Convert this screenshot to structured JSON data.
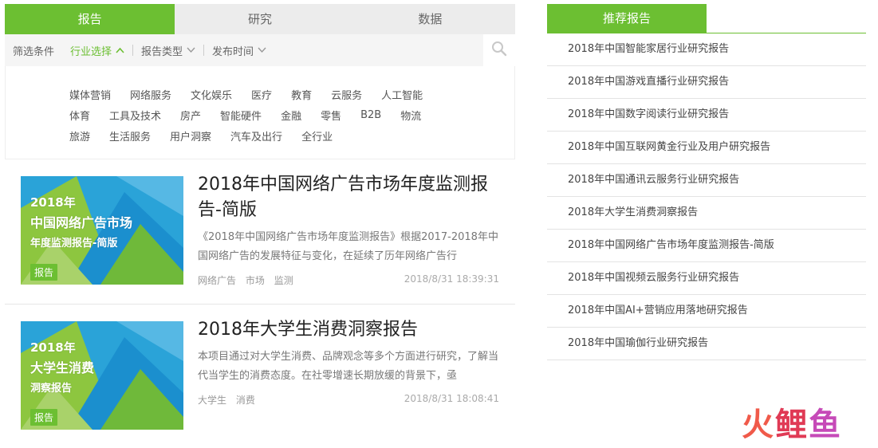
{
  "tabs": [
    "报告",
    "研究",
    "数据"
  ],
  "filter": {
    "label": "筛选条件",
    "industry": "行业选择",
    "type": "报告类型",
    "time": "发布时间"
  },
  "tags": [
    [
      "媒体营销",
      "网络服务",
      "文化娱乐",
      "医疗",
      "教育",
      "云服务",
      "人工智能"
    ],
    [
      "体育",
      "工具及技术",
      "房产",
      "智能硬件",
      "金融",
      "零售",
      "B2B",
      "物流"
    ],
    [
      "旅游",
      "生活服务",
      "用户洞察",
      "汽车及出行",
      "全行业"
    ]
  ],
  "articles": [
    {
      "thumb_lines": [
        "2018年",
        "中国网络广告市场",
        "年度监测报告-简版"
      ],
      "badge": "报告",
      "title": "2018年中国网络广告市场年度监测报告-简版",
      "desc": "《2018年中国网络广告市场年度监测报告》根据2017-2018年中国网络广告的发展特征与变化，在延续了历年网络广告行",
      "tags": [
        "网络广告",
        "市场",
        "监测"
      ],
      "time": "2018/8/31 18:39:31"
    },
    {
      "thumb_lines": [
        "2018年",
        "大学生消费",
        "洞察报告"
      ],
      "badge": "报告",
      "title": "2018年大学生消费洞察报告",
      "desc": "本项目通过对大学生消费、品牌观念等多个方面进行研究，了解当代当学生的消费态度。在社零增速长期放缓的背景下，亟",
      "tags": [
        "大学生",
        "消费"
      ],
      "time": "2018/8/31 18:08:41"
    }
  ],
  "recommend": {
    "title": "推荐报告",
    "items": [
      "2018年中国智能家居行业研究报告",
      "2018年中国游戏直播行业研究报告",
      "2018年中国数字阅读行业研究报告",
      "2018年中国互联网黄金行业及用户研究报告",
      "2018年中国通讯云服务行业研究报告",
      "2018年大学生消费洞察报告",
      "2018年中国网络广告市场年度监测报告-简版",
      "2018年中国视频云服务行业研究报告",
      "2018年中国AI+营销应用落地研究报告",
      "2018年中国瑜伽行业研究报告"
    ]
  },
  "watermark": [
    "火",
    "鲤",
    "鱼"
  ],
  "colors": {
    "accent": "#6cbf32"
  }
}
